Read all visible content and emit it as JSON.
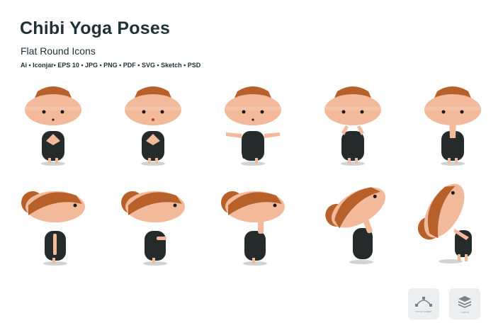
{
  "header": {
    "title": "Chibi Yoga Poses",
    "subtitle": "Flat Round Icons",
    "formats": "Ai • Iconjar• EPS 10 • JPG • PNG • PDF • SVG • Sketch • PSD"
  },
  "badges": [
    {
      "label": "vector shape",
      "icon": "vector-shape-icon"
    },
    {
      "label": "Layers",
      "icon": "layers-icon"
    }
  ],
  "colors": {
    "hair": "#b8602a",
    "hair_light": "#c97a3a",
    "skin": "#f2b99a",
    "skin_light": "#f7cfb8",
    "body": "#242b2a",
    "shadow": "#cfd3d4"
  }
}
